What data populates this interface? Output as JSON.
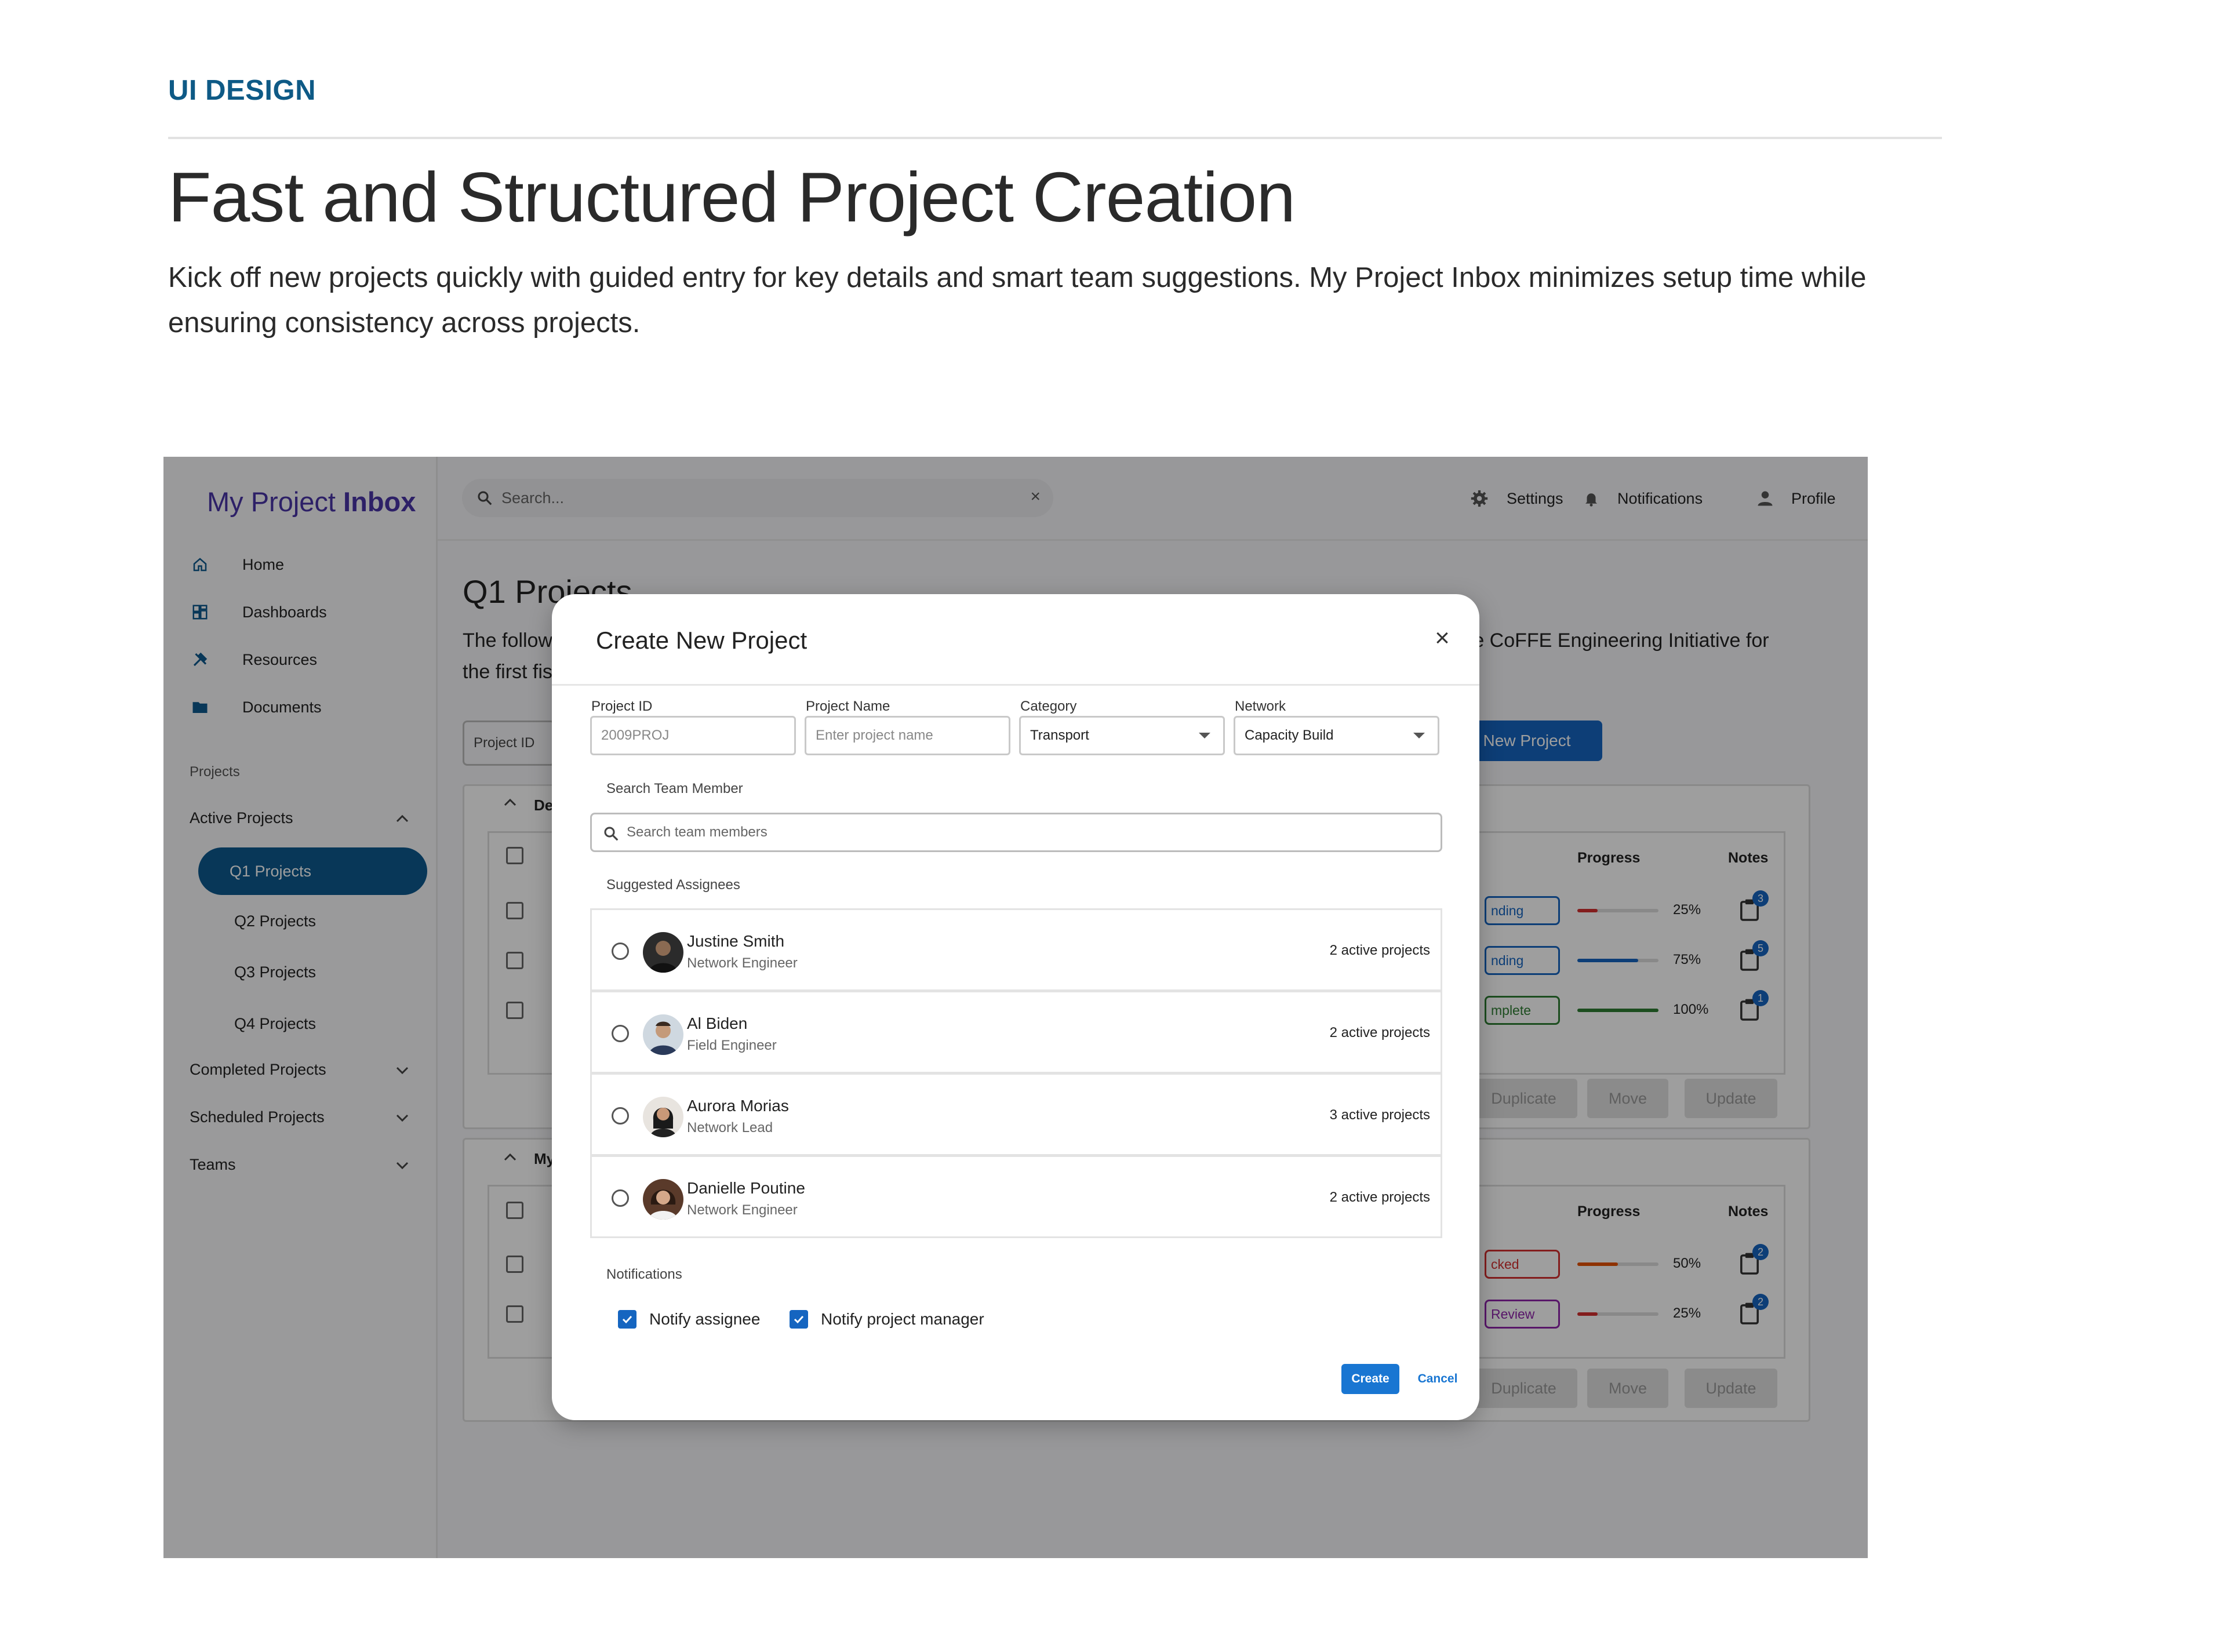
{
  "article": {
    "eyebrow": "UI DESIGN",
    "headline": "Fast and Structured Project Creation",
    "lede": "Kick off new projects quickly with guided entry for key details and smart team suggestions. My Project Inbox minimizes setup time while ensuring consistency across projects."
  },
  "app": {
    "logo_light": "My Project ",
    "logo_bold": "Inbox",
    "nav": [
      {
        "label": "Home",
        "icon": "home-icon"
      },
      {
        "label": "Dashboards",
        "icon": "dashboard-icon"
      },
      {
        "label": "Resources",
        "icon": "tools-icon"
      },
      {
        "label": "Documents",
        "icon": "folder-icon"
      }
    ],
    "projects_section": "Projects",
    "groups": {
      "active": "Active Projects",
      "completed": "Completed Projects",
      "scheduled": "Scheduled Projects",
      "teams": "Teams"
    },
    "subitems": [
      "Q1 Projects",
      "Q2 Projects",
      "Q3 Projects",
      "Q4 Projects"
    ],
    "search_placeholder": "Search...",
    "topbar": {
      "settings": "Settings",
      "notifications": "Notifications",
      "profile": "Profile"
    },
    "main": {
      "title": "Q1 Projects",
      "desc_left": "The follow",
      "desc_right": "the CoFFE Engineering Initiative for",
      "desc_line2": "the first fis",
      "project_id_label": "Project ID",
      "new_project": "New Project"
    },
    "table": {
      "progress_header": "Progress",
      "notes_header": "Notes",
      "section1_label": "De",
      "section2_label": "My",
      "rows1": [
        {
          "status": "nding",
          "progress": 25,
          "progress_label": "25%",
          "notes": "3",
          "color": "#d32f2f",
          "chip": "#1565c0"
        },
        {
          "status": "nding",
          "progress": 75,
          "progress_label": "75%",
          "notes": "5",
          "color": "#1565c0",
          "chip": "#1565c0"
        },
        {
          "status": "mplete",
          "progress": 100,
          "progress_label": "100%",
          "notes": "1",
          "color": "#2e7d32",
          "chip": "#2e7d32"
        }
      ],
      "rows2": [
        {
          "status": "cked",
          "progress": 50,
          "progress_label": "50%",
          "notes": "2",
          "color": "#e65100",
          "chip": "#d32f2f"
        },
        {
          "status": "Review",
          "progress": 25,
          "progress_label": "25%",
          "notes": "2",
          "color": "#d32f2f",
          "chip": "#8e24aa"
        }
      ],
      "actions": [
        "Duplicate",
        "Move",
        "Update"
      ]
    }
  },
  "modal": {
    "title": "Create New Project",
    "fields": {
      "project_id": {
        "label": "Project ID",
        "value": "2009PROJ"
      },
      "project_name": {
        "label": "Project Name",
        "placeholder": "Enter project name"
      },
      "category": {
        "label": "Category",
        "value": "Transport"
      },
      "network": {
        "label": "Network",
        "value": "Capacity Build"
      }
    },
    "search_team_label": "Search Team Member",
    "search_team_placeholder": "Search team members",
    "suggested_label": "Suggested Assignees",
    "assignees": [
      {
        "name": "Justine Smith",
        "role": "Network Engineer",
        "count": "2 active projects"
      },
      {
        "name": "Al Biden",
        "role": "Field Engineer",
        "count": "2 active projects"
      },
      {
        "name": "Aurora Morias",
        "role": "Network Lead",
        "count": "3 active projects"
      },
      {
        "name": "Danielle Poutine",
        "role": "Network Engineer",
        "count": "2 active projects"
      }
    ],
    "notifications_label": "Notifications",
    "notify_assignee": "Notify assignee",
    "notify_manager": "Notify project manager",
    "create": "Create",
    "cancel": "Cancel"
  }
}
